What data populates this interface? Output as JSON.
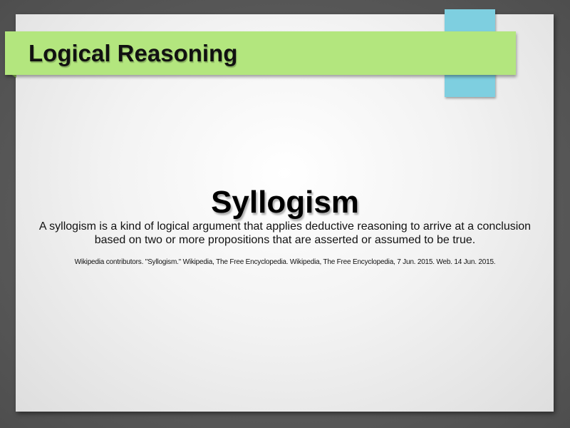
{
  "slide": {
    "title": "Logical Reasoning",
    "heading": "Syllogism",
    "body": "A syllogism is a kind of logical argument that applies deductive reasoning to arrive at a conclusion based on two or more propositions that are asserted or assumed to be true.",
    "citation": "Wikipedia contributors. \"Syllogism.\" Wikipedia, The Free Encyclopedia. Wikipedia, The Free Encyclopedia, 7 Jun. 2015. Web. 14 Jun. 2015."
  },
  "colors": {
    "background": "#555555",
    "slide": "#f3f3f3",
    "title_bar": "#b3e67e",
    "accent_tab": "#7ecfe0",
    "text": "#111111"
  }
}
